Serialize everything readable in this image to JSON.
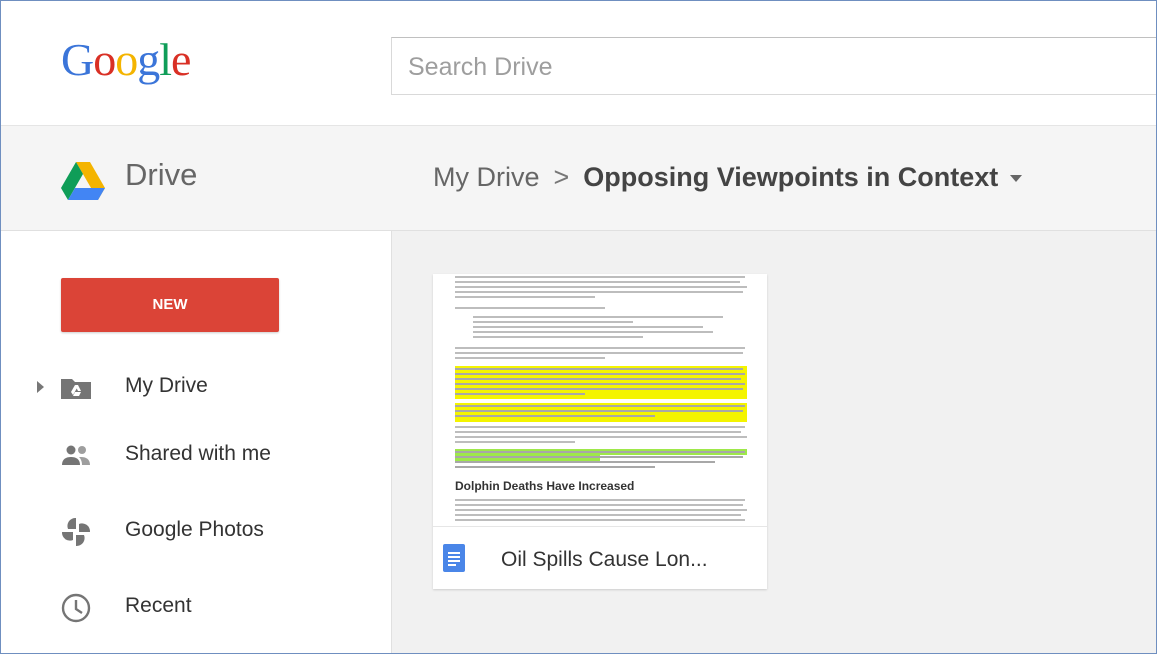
{
  "header": {
    "logo_letters": [
      {
        "ch": "G",
        "color": "#3b75d9"
      },
      {
        "ch": "o",
        "color": "#d93025"
      },
      {
        "ch": "o",
        "color": "#f4b400"
      },
      {
        "ch": "g",
        "color": "#3b75d9"
      },
      {
        "ch": "l",
        "color": "#0f9d58"
      },
      {
        "ch": "e",
        "color": "#d93025"
      }
    ],
    "search_placeholder": "Search Drive"
  },
  "drivebar": {
    "title": "Drive",
    "breadcrumb": {
      "root": "My Drive",
      "separator": ">",
      "current": "Opposing Viewpoints in Context"
    }
  },
  "sidebar": {
    "new_label": "NEW",
    "items": [
      {
        "label": "My Drive",
        "icon": "my-drive-icon"
      },
      {
        "label": "Shared with me",
        "icon": "shared-icon"
      },
      {
        "label": "Google Photos",
        "icon": "photos-icon"
      },
      {
        "label": "Recent",
        "icon": "clock-icon"
      }
    ]
  },
  "files": [
    {
      "name": "Oil Spills Cause Lon...",
      "type": "document",
      "preview_heading": "Dolphin Deaths Have Increased"
    }
  ],
  "colors": {
    "new_button": "#db4437",
    "doc_icon": "#4a86e8",
    "highlight_yellow": "#f4f400",
    "highlight_green": "#9ee84a"
  }
}
